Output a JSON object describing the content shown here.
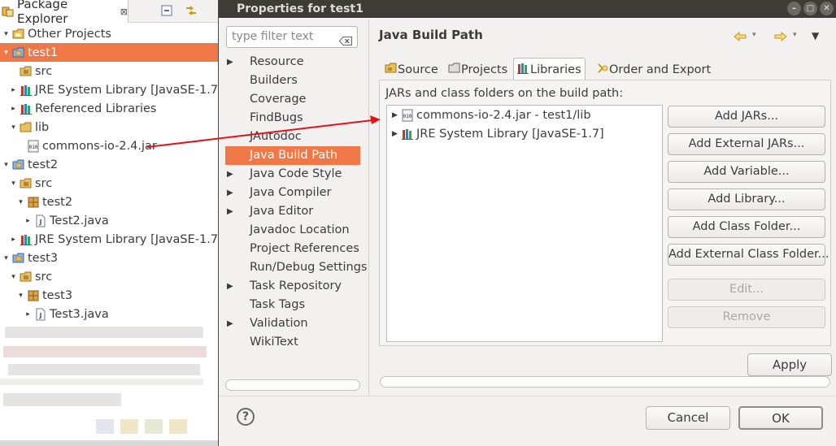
{
  "package_explorer": {
    "tab_label": "Package Explorer",
    "close_glyph": "⊠",
    "tree": [
      {
        "label": "Other Projects",
        "indent": 0,
        "twisty": "▾",
        "icon": "working-set-icon"
      },
      {
        "label": "test1",
        "indent": 0,
        "twisty": "▾",
        "icon": "project-icon",
        "selected": true
      },
      {
        "label": "src",
        "indent": 1,
        "twisty": "",
        "icon": "source-folder-icon"
      },
      {
        "label": "JRE System Library [JavaSE-1.7]",
        "indent": 1,
        "twisty": "▸",
        "icon": "library-icon"
      },
      {
        "label": "Referenced Libraries",
        "indent": 1,
        "twisty": "▸",
        "icon": "library-icon"
      },
      {
        "label": "lib",
        "indent": 1,
        "twisty": "▾",
        "icon": "folder-icon"
      },
      {
        "label": "commons-io-2.4.jar",
        "indent": 2,
        "twisty": "",
        "icon": "jar-icon"
      },
      {
        "label": "test2",
        "indent": 0,
        "twisty": "▾",
        "icon": "project-icon"
      },
      {
        "label": "src",
        "indent": 1,
        "twisty": "▾",
        "icon": "source-folder-icon"
      },
      {
        "label": "test2",
        "indent": 2,
        "twisty": "▾",
        "icon": "package-icon"
      },
      {
        "label": "Test2.java",
        "indent": 3,
        "twisty": "▸",
        "icon": "java-file-icon"
      },
      {
        "label": "JRE System Library [JavaSE-1.7]",
        "indent": 1,
        "twisty": "▸",
        "icon": "library-icon"
      },
      {
        "label": "test3",
        "indent": 0,
        "twisty": "▾",
        "icon": "project-icon"
      },
      {
        "label": "src",
        "indent": 1,
        "twisty": "▾",
        "icon": "source-folder-icon"
      },
      {
        "label": "test3",
        "indent": 2,
        "twisty": "▾",
        "icon": "package-icon"
      },
      {
        "label": "Test3.java",
        "indent": 3,
        "twisty": "▸",
        "icon": "java-file-icon"
      }
    ]
  },
  "dialog": {
    "title": "Properties for test1",
    "window_buttons": [
      "–",
      "□",
      "✕"
    ],
    "filter_placeholder": "type filter text",
    "nav": [
      {
        "label": "Resource",
        "arrow": "▶"
      },
      {
        "label": "Builders",
        "arrow": ""
      },
      {
        "label": "Coverage",
        "arrow": ""
      },
      {
        "label": "FindBugs",
        "arrow": ""
      },
      {
        "label": "JAutodoc",
        "arrow": ""
      },
      {
        "label": "Java Build Path",
        "arrow": "",
        "selected": true
      },
      {
        "label": "Java Code Style",
        "arrow": "▶"
      },
      {
        "label": "Java Compiler",
        "arrow": "▶"
      },
      {
        "label": "Java Editor",
        "arrow": "▶"
      },
      {
        "label": "Javadoc Location",
        "arrow": ""
      },
      {
        "label": "Project References",
        "arrow": ""
      },
      {
        "label": "Run/Debug Settings",
        "arrow": ""
      },
      {
        "label": "Task Repository",
        "arrow": "▶"
      },
      {
        "label": "Task Tags",
        "arrow": ""
      },
      {
        "label": "Validation",
        "arrow": "▶"
      },
      {
        "label": "WikiText",
        "arrow": ""
      }
    ],
    "page_title": "Java Build Path",
    "tabs": [
      {
        "label": "Source",
        "icon": "source-tab-icon"
      },
      {
        "label": "Projects",
        "icon": "projects-tab-icon"
      },
      {
        "label": "Libraries",
        "icon": "libraries-tab-icon",
        "active": true
      },
      {
        "label": "Order and Export",
        "icon": "order-export-tab-icon"
      }
    ],
    "list_label": "JARs and class folders on the build path:",
    "list_items": [
      {
        "label": "commons-io-2.4.jar - test1/lib",
        "icon": "jar-icon"
      },
      {
        "label": "JRE System Library [JavaSE-1.7]",
        "icon": "library-icon"
      }
    ],
    "buttons": [
      {
        "label": "Add JARs...",
        "enabled": true
      },
      {
        "label": "Add External JARs...",
        "enabled": true
      },
      {
        "label": "Add Variable...",
        "enabled": true
      },
      {
        "label": "Add Library...",
        "enabled": true
      },
      {
        "label": "Add Class Folder...",
        "enabled": true
      },
      {
        "label": "Add External Class Folder...",
        "enabled": true
      },
      {
        "label": "Edit...",
        "enabled": false
      },
      {
        "label": "Remove",
        "enabled": false
      }
    ],
    "apply_label": "Apply",
    "help_glyph": "?",
    "cancel_label": "Cancel",
    "ok_label": "OK"
  },
  "colors": {
    "selection": "#f07746",
    "titlebar": "#3d3c37",
    "annotation_arrow": "#e0141c"
  }
}
